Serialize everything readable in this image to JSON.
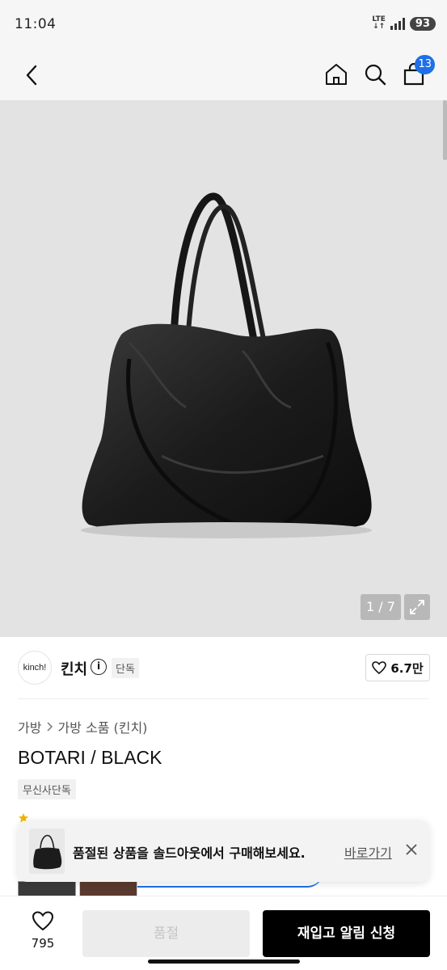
{
  "status": {
    "time": "11:04",
    "network_top": "LTE",
    "network_bottom": "↓↑",
    "battery": "93"
  },
  "nav": {
    "cart_count": "13",
    "icons": [
      "back-icon",
      "home-icon",
      "search-icon",
      "cart-icon"
    ]
  },
  "gallery": {
    "counter": "1 / 7",
    "current_index": 1,
    "total_images": 7
  },
  "brand": {
    "logo_text": "kinch!",
    "name": "킨치",
    "info_glyph": "i",
    "tag": "단독",
    "like_count": "6.7만"
  },
  "product": {
    "breadcrumb": [
      "가방",
      "가방 소품 (킨치)"
    ],
    "title": "BOTARI / BLACK",
    "exclusive_tag": "무신사단독"
  },
  "toast": {
    "message": "품절된 상품을 솔드아웃에서 구매해보세요.",
    "link": "바로가기"
  },
  "bottom": {
    "wish_count": "795",
    "soldout_label": "품절",
    "restock_label": "재입고 알림 신청"
  },
  "colors": {
    "accent": "#1e6fe8",
    "primary_button": "#000000",
    "disabled_button": "#ececec",
    "hero_bg": "#e3e3e3"
  }
}
